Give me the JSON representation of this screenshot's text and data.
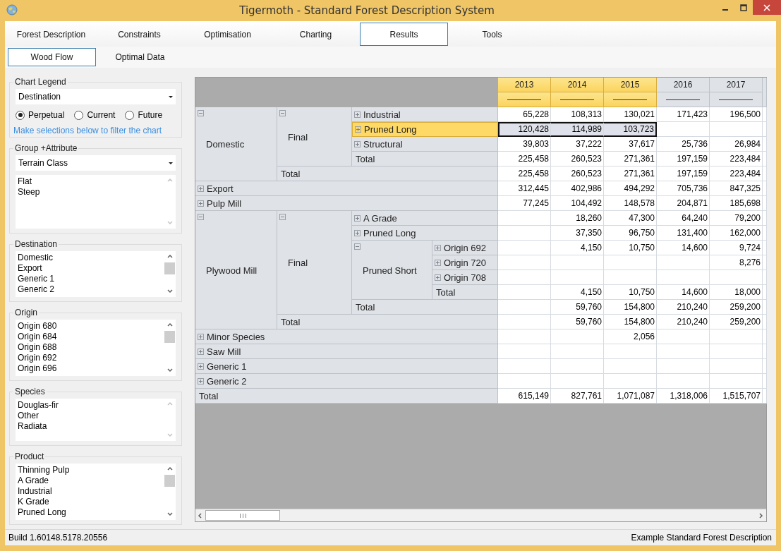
{
  "window": {
    "title": "Tigermoth - Standard Forest Description System"
  },
  "tabs": [
    {
      "label": "Forest Description",
      "selected": false
    },
    {
      "label": "Constraints",
      "selected": false
    },
    {
      "label": "Optimisation",
      "selected": false
    },
    {
      "label": "Charting",
      "selected": false
    },
    {
      "label": "Results",
      "selected": true
    },
    {
      "label": "Tools",
      "selected": false
    }
  ],
  "subtabs": [
    {
      "label": "Wood Flow",
      "selected": true
    },
    {
      "label": "Optimal Data",
      "selected": false
    }
  ],
  "sidebar": {
    "chart_legend": {
      "title": "Chart Legend",
      "dropdown": "Destination",
      "radios": [
        {
          "label": "Perpetual",
          "selected": true
        },
        {
          "label": "Current",
          "selected": false
        },
        {
          "label": "Future",
          "selected": false
        }
      ],
      "link": "Make selections below to filter the chart"
    },
    "group_attribute": {
      "title": "Group +Attribute",
      "dropdown": "Terrain Class",
      "items": [
        "Flat",
        "Steep"
      ],
      "scrollable": false
    },
    "filters": [
      {
        "title": "Destination",
        "items": [
          "Domestic",
          "Export",
          "Generic 1",
          "Generic 2"
        ],
        "scrollable": true
      },
      {
        "title": "Origin",
        "items": [
          "Origin 680",
          "Origin 684",
          "Origin 688",
          "Origin 692",
          "Origin 696"
        ],
        "scrollable": true
      },
      {
        "title": "Species",
        "items": [
          "Douglas-fir",
          "Other",
          "Radiata"
        ],
        "scrollable": false
      },
      {
        "title": "Product",
        "items": [
          "Thinning Pulp",
          "A Grade",
          "Industrial",
          "K Grade",
          "Pruned Long"
        ],
        "scrollable": true
      }
    ]
  },
  "pivot": {
    "columns": [
      {
        "label": "2013",
        "selected": true
      },
      {
        "label": "2014",
        "selected": true
      },
      {
        "label": "2015",
        "selected": true
      },
      {
        "label": "2016",
        "selected": false
      },
      {
        "label": "2017",
        "selected": false
      }
    ],
    "rows": [
      {
        "label": "Domestic",
        "expanded": true,
        "children": [
          {
            "label": "Final",
            "expanded": true,
            "children": [
              {
                "label": "Industrial",
                "expanded": false,
                "selected": false,
                "values": [
                  {
                    "kind": "number",
                    "text": "65,228"
                  },
                  {
                    "kind": "number",
                    "text": "108,313"
                  },
                  {
                    "kind": "number",
                    "text": "130,021"
                  },
                  {
                    "kind": "number",
                    "text": "171,423"
                  },
                  {
                    "kind": "number",
                    "text": "196,500"
                  }
                ]
              },
              {
                "label": "Pruned Long",
                "expanded": false,
                "selected": true,
                "values": [
                  {
                    "kind": "number",
                    "text": "120,428"
                  },
                  {
                    "kind": "number",
                    "text": "114,989"
                  },
                  {
                    "kind": "number",
                    "text": "103,723"
                  },
                  {
                    "kind": "blank"
                  },
                  {
                    "kind": "blank"
                  }
                ]
              },
              {
                "label": "Structural",
                "expanded": false,
                "selected": false,
                "values": [
                  {
                    "kind": "number",
                    "text": "39,803"
                  },
                  {
                    "kind": "number",
                    "text": "37,222"
                  },
                  {
                    "kind": "number",
                    "text": "37,617"
                  },
                  {
                    "kind": "number",
                    "text": "25,736"
                  },
                  {
                    "kind": "number",
                    "text": "26,984"
                  }
                ]
              }
            ],
            "total": {
              "label": "Total",
              "values": [
                {
                  "kind": "number",
                  "text": "225,458"
                },
                {
                  "kind": "number",
                  "text": "260,523"
                },
                {
                  "kind": "number",
                  "text": "271,361"
                },
                {
                  "kind": "number",
                  "text": "197,159"
                },
                {
                  "kind": "number",
                  "text": "223,484"
                }
              ]
            }
          }
        ],
        "total": {
          "label": "Total",
          "values": [
            {
              "kind": "number",
              "text": "225,458"
            },
            {
              "kind": "number",
              "text": "260,523"
            },
            {
              "kind": "number",
              "text": "271,361"
            },
            {
              "kind": "number",
              "text": "197,159"
            },
            {
              "kind": "number",
              "text": "223,484"
            }
          ]
        }
      },
      {
        "label": "Export",
        "expanded": false,
        "selected": false,
        "values": [
          {
            "kind": "number",
            "text": "312,445"
          },
          {
            "kind": "number",
            "text": "402,986"
          },
          {
            "kind": "number",
            "text": "494,292"
          },
          {
            "kind": "number",
            "text": "705,736"
          },
          {
            "kind": "number",
            "text": "847,325"
          }
        ]
      },
      {
        "label": "Pulp Mill",
        "expanded": false,
        "selected": false,
        "values": [
          {
            "kind": "number",
            "text": "77,245"
          },
          {
            "kind": "number",
            "text": "104,492"
          },
          {
            "kind": "number",
            "text": "148,578"
          },
          {
            "kind": "number",
            "text": "204,871"
          },
          {
            "kind": "number",
            "text": "185,698"
          }
        ]
      },
      {
        "label": "Plywood Mill",
        "expanded": true,
        "children": [
          {
            "label": "Final",
            "expanded": true,
            "children": [
              {
                "label": "A Grade",
                "expanded": false,
                "selected": false,
                "values": [
                  {
                    "kind": "blank"
                  },
                  {
                    "kind": "number",
                    "text": "18,260"
                  },
                  {
                    "kind": "number",
                    "text": "47,300"
                  },
                  {
                    "kind": "number",
                    "text": "64,240"
                  },
                  {
                    "kind": "number",
                    "text": "79,200"
                  }
                ]
              },
              {
                "label": "Pruned Long",
                "expanded": false,
                "selected": false,
                "values": [
                  {
                    "kind": "blank"
                  },
                  {
                    "kind": "number",
                    "text": "37,350"
                  },
                  {
                    "kind": "number",
                    "text": "96,750"
                  },
                  {
                    "kind": "number",
                    "text": "131,400"
                  },
                  {
                    "kind": "number",
                    "text": "162,000"
                  }
                ]
              },
              {
                "label": "Pruned Short",
                "expanded": true,
                "children": [
                  {
                    "label": "Origin 692",
                    "expanded": false,
                    "selected": false,
                    "values": [
                      {
                        "kind": "blank"
                      },
                      {
                        "kind": "number",
                        "text": "4,150"
                      },
                      {
                        "kind": "number",
                        "text": "10,750"
                      },
                      {
                        "kind": "number",
                        "text": "14,600"
                      },
                      {
                        "kind": "number",
                        "text": "9,724"
                      }
                    ]
                  },
                  {
                    "label": "Origin 720",
                    "expanded": false,
                    "selected": false,
                    "values": [
                      {
                        "kind": "blank"
                      },
                      {
                        "kind": "blank"
                      },
                      {
                        "kind": "blank"
                      },
                      {
                        "kind": "blank"
                      },
                      {
                        "kind": "number",
                        "text": "8,276"
                      }
                    ]
                  },
                  {
                    "label": "Origin 708",
                    "expanded": false,
                    "selected": false,
                    "values": [
                      {
                        "kind": "blank"
                      },
                      {
                        "kind": "blank"
                      },
                      {
                        "kind": "blank"
                      },
                      {
                        "kind": "blank"
                      },
                      {
                        "kind": "blank"
                      }
                    ]
                  }
                ],
                "total": {
                  "label": "Total",
                  "values": [
                    {
                      "kind": "blank"
                    },
                    {
                      "kind": "number",
                      "text": "4,150"
                    },
                    {
                      "kind": "number",
                      "text": "10,750"
                    },
                    {
                      "kind": "number",
                      "text": "14,600"
                    },
                    {
                      "kind": "number",
                      "text": "18,000"
                    }
                  ]
                }
              }
            ],
            "total": {
              "label": "Total",
              "values": [
                {
                  "kind": "blank"
                },
                {
                  "kind": "number",
                  "text": "59,760"
                },
                {
                  "kind": "number",
                  "text": "154,800"
                },
                {
                  "kind": "number",
                  "text": "210,240"
                },
                {
                  "kind": "number",
                  "text": "259,200"
                }
              ]
            }
          }
        ],
        "total": {
          "label": "Total",
          "values": [
            {
              "kind": "blank"
            },
            {
              "kind": "number",
              "text": "59,760"
            },
            {
              "kind": "number",
              "text": "154,800"
            },
            {
              "kind": "number",
              "text": "210,240"
            },
            {
              "kind": "number",
              "text": "259,200"
            }
          ]
        }
      },
      {
        "label": "Minor Species",
        "expanded": false,
        "selected": false,
        "values": [
          {
            "kind": "blank"
          },
          {
            "kind": "blank"
          },
          {
            "kind": "number",
            "text": "2,056"
          },
          {
            "kind": "blank"
          },
          {
            "kind": "blank"
          }
        ]
      },
      {
        "label": "Saw Mill",
        "expanded": false,
        "selected": false,
        "values": [
          {
            "kind": "blank"
          },
          {
            "kind": "blank"
          },
          {
            "kind": "blank"
          },
          {
            "kind": "blank"
          },
          {
            "kind": "blank"
          }
        ]
      },
      {
        "label": "Generic 1",
        "expanded": false,
        "selected": false,
        "values": [
          {
            "kind": "blank"
          },
          {
            "kind": "blank"
          },
          {
            "kind": "blank"
          },
          {
            "kind": "blank"
          },
          {
            "kind": "blank"
          }
        ]
      },
      {
        "label": "Generic 2",
        "expanded": false,
        "selected": false,
        "values": [
          {
            "kind": "blank"
          },
          {
            "kind": "blank"
          },
          {
            "kind": "blank"
          },
          {
            "kind": "blank"
          },
          {
            "kind": "blank"
          }
        ]
      }
    ],
    "total": {
      "label": "Total",
      "values": [
        {
          "kind": "number",
          "text": "615,149"
        },
        {
          "kind": "number",
          "text": "827,761"
        },
        {
          "kind": "number",
          "text": "1,071,087"
        },
        {
          "kind": "number",
          "text": "1,318,006"
        },
        {
          "kind": "number",
          "text": "1,515,707"
        }
      ]
    }
  },
  "status_bar": {
    "build": "Build 1.60148.5178.20556",
    "project": "Example Standard Forest Description"
  }
}
